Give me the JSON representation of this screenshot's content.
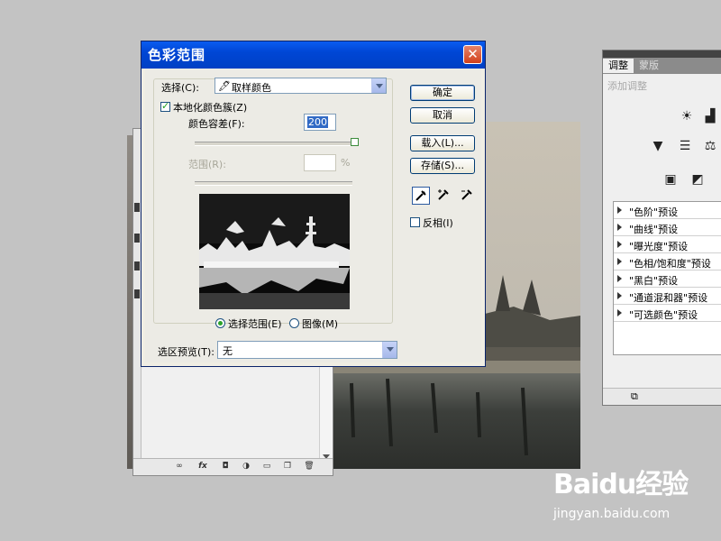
{
  "dialog": {
    "title": "色彩范围",
    "close_glyph": "✕",
    "select_label": "选择(C):",
    "select_value": "取样颜色",
    "localized_label": "本地化颜色簇(Z)",
    "tolerance_label": "颜色容差(F):",
    "tolerance_value": "200",
    "range_label": "范围(R):",
    "range_value": "",
    "range_unit": "%",
    "radio_selection": "选择范围(E)",
    "radio_image": "图像(M)",
    "selection_preview_label": "选区预览(T):",
    "selection_preview_value": "无",
    "buttons": {
      "ok": "确定",
      "cancel": "取消",
      "load": "载入(L)...",
      "save": "存储(S)..."
    },
    "invert_label": "反相(I)",
    "tolerance_fraction": 1.0,
    "localized_checked": true,
    "invert_checked": false,
    "selected_radio": "selection"
  },
  "adjustments_panel": {
    "tabs": [
      "调整",
      "蒙版"
    ],
    "hint": "添加调整",
    "presets": [
      "\"色阶\"预设",
      "\"曲线\"预设",
      "\"曝光度\"预设",
      "\"色相/饱和度\"预设",
      "\"黑白\"预设",
      "\"通道混和器\"预设",
      "\"可选颜色\"预设"
    ]
  },
  "watermark": {
    "brand": "Baidu经验",
    "url": "jingyan.baidu.com"
  },
  "colors": {
    "desktop": "#c3c3c3",
    "titlebar": "#0046d5",
    "close": "#d2401b",
    "selection": "#316ac5"
  }
}
